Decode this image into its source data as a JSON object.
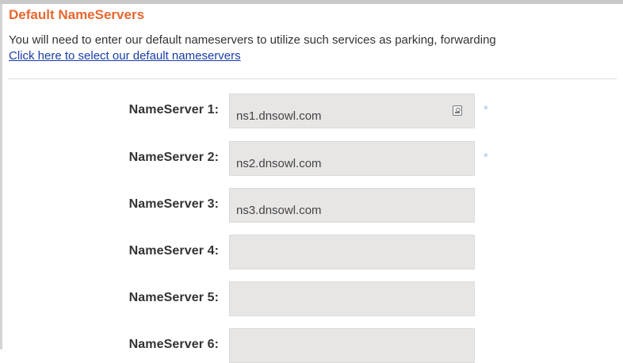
{
  "section": {
    "title": "Default NameServers",
    "description": "You will need to enter our default nameservers to utilize such services as parking, forwarding",
    "link_text": "Click here to select our default nameservers"
  },
  "nameservers": [
    {
      "label": "NameServer 1:",
      "value": "ns1.dnsowl.com",
      "required": "*"
    },
    {
      "label": "NameServer 2:",
      "value": "ns2.dnsowl.com",
      "required": "*"
    },
    {
      "label": "NameServer 3:",
      "value": "ns3.dnsowl.com",
      "required": ""
    },
    {
      "label": "NameServer 4:",
      "value": "",
      "required": ""
    },
    {
      "label": "NameServer 5:",
      "value": "",
      "required": ""
    },
    {
      "label": "NameServer 6:",
      "value": "",
      "required": ""
    }
  ],
  "icons": {
    "autofill": "contact-card-icon"
  },
  "colors": {
    "title": "#e8672f",
    "link": "#1a3da8",
    "required": "#9fc2e4",
    "field_bg": "#e8e6e5"
  }
}
